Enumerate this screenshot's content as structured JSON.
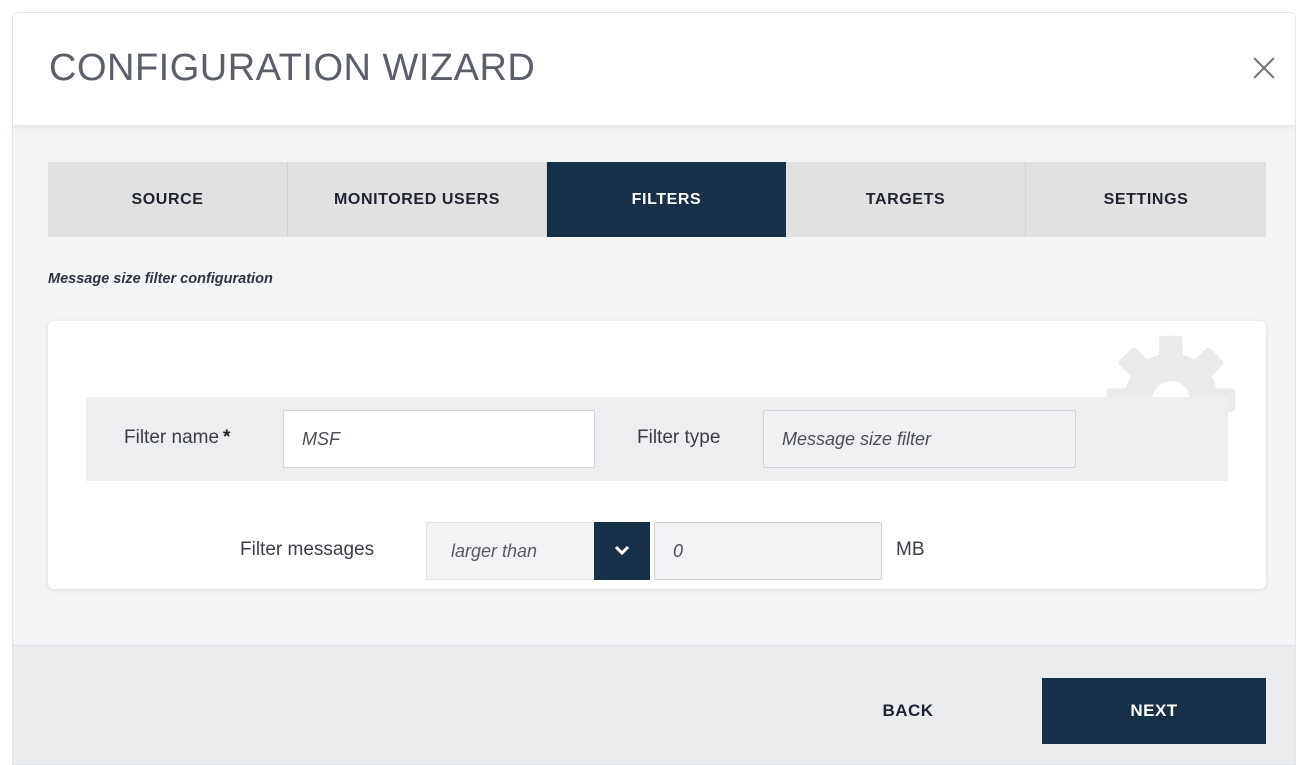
{
  "dialog": {
    "title": "CONFIGURATION WIZARD",
    "close_icon": "close-icon"
  },
  "tabs": [
    {
      "label": "SOURCE",
      "active": false
    },
    {
      "label": "MONITORED USERS",
      "active": false
    },
    {
      "label": "FILTERS",
      "active": true
    },
    {
      "label": "TARGETS",
      "active": false
    },
    {
      "label": "SETTINGS",
      "active": false
    }
  ],
  "section": {
    "caption": "Message size filter configuration"
  },
  "form": {
    "filter_name": {
      "label": "Filter name",
      "required_mark": "*",
      "value": "MSF"
    },
    "filter_type": {
      "label": "Filter type",
      "value": "Message size filter"
    },
    "filter_messages": {
      "label": "Filter messages",
      "condition": "larger than",
      "size_value": "0",
      "unit": "MB"
    }
  },
  "footer": {
    "back_label": "BACK",
    "next_label": "NEXT"
  },
  "colors": {
    "accent": "#173049",
    "tab_inactive": "#e1e1e1",
    "background": "#f4f5f6"
  }
}
